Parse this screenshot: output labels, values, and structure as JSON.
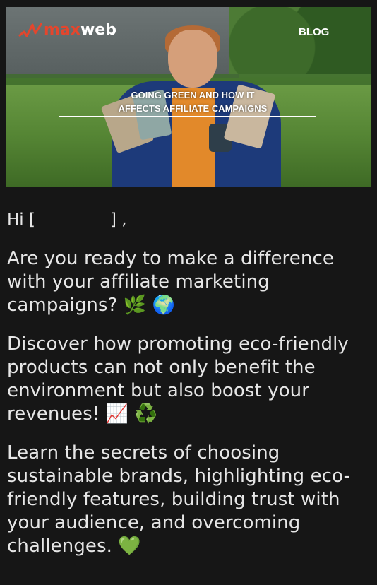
{
  "header": {
    "logo_max": "max",
    "logo_web": "web",
    "nav_blog": "BLOG",
    "caption_line1": "GOING GREEN AND HOW IT",
    "caption_line2": "AFFECTS AFFILIATE CAMPAIGNS"
  },
  "email": {
    "greeting_open": "Hi [",
    "greeting_close": "] ,",
    "paragraphs": [
      {
        "text": "Are you ready to make a difference with your affiliate marketing campaigns? ",
        "emojis": "🌿 🌍"
      },
      {
        "text": "Discover how promoting eco-friendly products can not only benefit the environment but also boost your revenues! ",
        "emojis": "📈 ♻️"
      },
      {
        "text": "Learn the secrets of choosing sustainable brands, highlighting eco-friendly features, building trust with your audience, and overcoming challenges. ",
        "emojis": "💚"
      }
    ]
  },
  "colors": {
    "background": "#161616",
    "brand_red": "#e4462d",
    "text": "#e6e6e6"
  }
}
